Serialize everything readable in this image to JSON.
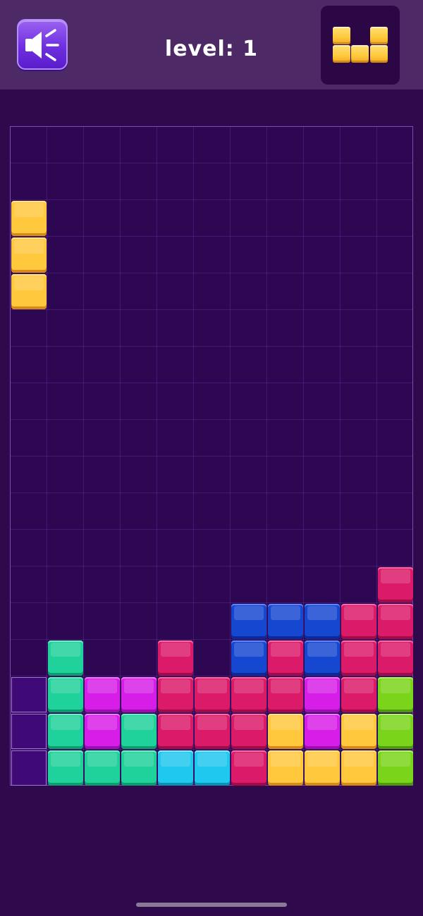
{
  "header": {
    "sound_button_icon": "speaker-sound-on-icon",
    "level_text": "level: 1",
    "next_piece": {
      "color": "#ffc83d",
      "shape": [
        [
          1,
          0,
          1
        ],
        [
          1,
          1,
          1
        ]
      ]
    }
  },
  "board": {
    "columns": 11,
    "rows": 18,
    "colors": {
      "yellow": "#ffc83d",
      "green": "#1fd19a",
      "magenta": "#d71ee8",
      "red": "#dc1a6a",
      "cyan": "#1fc8ee",
      "blue": "#1547d1",
      "lime": "#7ad51a",
      "empty": "#3f0a78"
    },
    "active_piece": {
      "color": "yellow",
      "cells": [
        [
          2,
          0
        ],
        [
          3,
          0
        ],
        [
          4,
          0
        ]
      ]
    },
    "grid": [
      [
        ".",
        ".",
        ".",
        ".",
        ".",
        ".",
        ".",
        ".",
        ".",
        ".",
        "."
      ],
      [
        ".",
        ".",
        ".",
        ".",
        ".",
        ".",
        ".",
        ".",
        ".",
        ".",
        "."
      ],
      [
        ".",
        ".",
        ".",
        ".",
        ".",
        ".",
        ".",
        ".",
        ".",
        ".",
        "."
      ],
      [
        ".",
        ".",
        ".",
        ".",
        ".",
        ".",
        ".",
        ".",
        ".",
        ".",
        "."
      ],
      [
        ".",
        ".",
        ".",
        ".",
        ".",
        ".",
        ".",
        ".",
        ".",
        ".",
        "."
      ],
      [
        ".",
        ".",
        ".",
        ".",
        ".",
        ".",
        ".",
        ".",
        ".",
        ".",
        "."
      ],
      [
        ".",
        ".",
        ".",
        ".",
        ".",
        ".",
        ".",
        ".",
        ".",
        ".",
        "."
      ],
      [
        ".",
        ".",
        ".",
        ".",
        ".",
        ".",
        ".",
        ".",
        ".",
        ".",
        "."
      ],
      [
        ".",
        ".",
        ".",
        ".",
        ".",
        ".",
        ".",
        ".",
        ".",
        ".",
        "."
      ],
      [
        ".",
        ".",
        ".",
        ".",
        ".",
        ".",
        ".",
        ".",
        ".",
        ".",
        "."
      ],
      [
        ".",
        ".",
        ".",
        ".",
        ".",
        ".",
        ".",
        ".",
        ".",
        ".",
        "."
      ],
      [
        ".",
        ".",
        ".",
        ".",
        ".",
        ".",
        ".",
        ".",
        ".",
        ".",
        "."
      ],
      [
        ".",
        ".",
        ".",
        ".",
        ".",
        ".",
        ".",
        ".",
        ".",
        ".",
        "red"
      ],
      [
        ".",
        ".",
        ".",
        ".",
        ".",
        ".",
        "blue",
        "blue",
        "blue",
        "red",
        "red"
      ],
      [
        ".",
        "green",
        ".",
        ".",
        "red",
        ".",
        "blue",
        "red",
        "blue",
        "red",
        "red"
      ],
      [
        "empty",
        "green",
        "magenta",
        "magenta",
        "red",
        "red",
        "red",
        "red",
        "magenta",
        "red",
        "lime"
      ],
      [
        "empty",
        "green",
        "magenta",
        "green",
        "red",
        "red",
        "red",
        "yellow",
        "magenta",
        "yellow",
        "lime"
      ],
      [
        "empty",
        "green",
        "green",
        "green",
        "cyan",
        "cyan",
        "red",
        "yellow",
        "yellow",
        "yellow",
        "lime"
      ]
    ]
  }
}
